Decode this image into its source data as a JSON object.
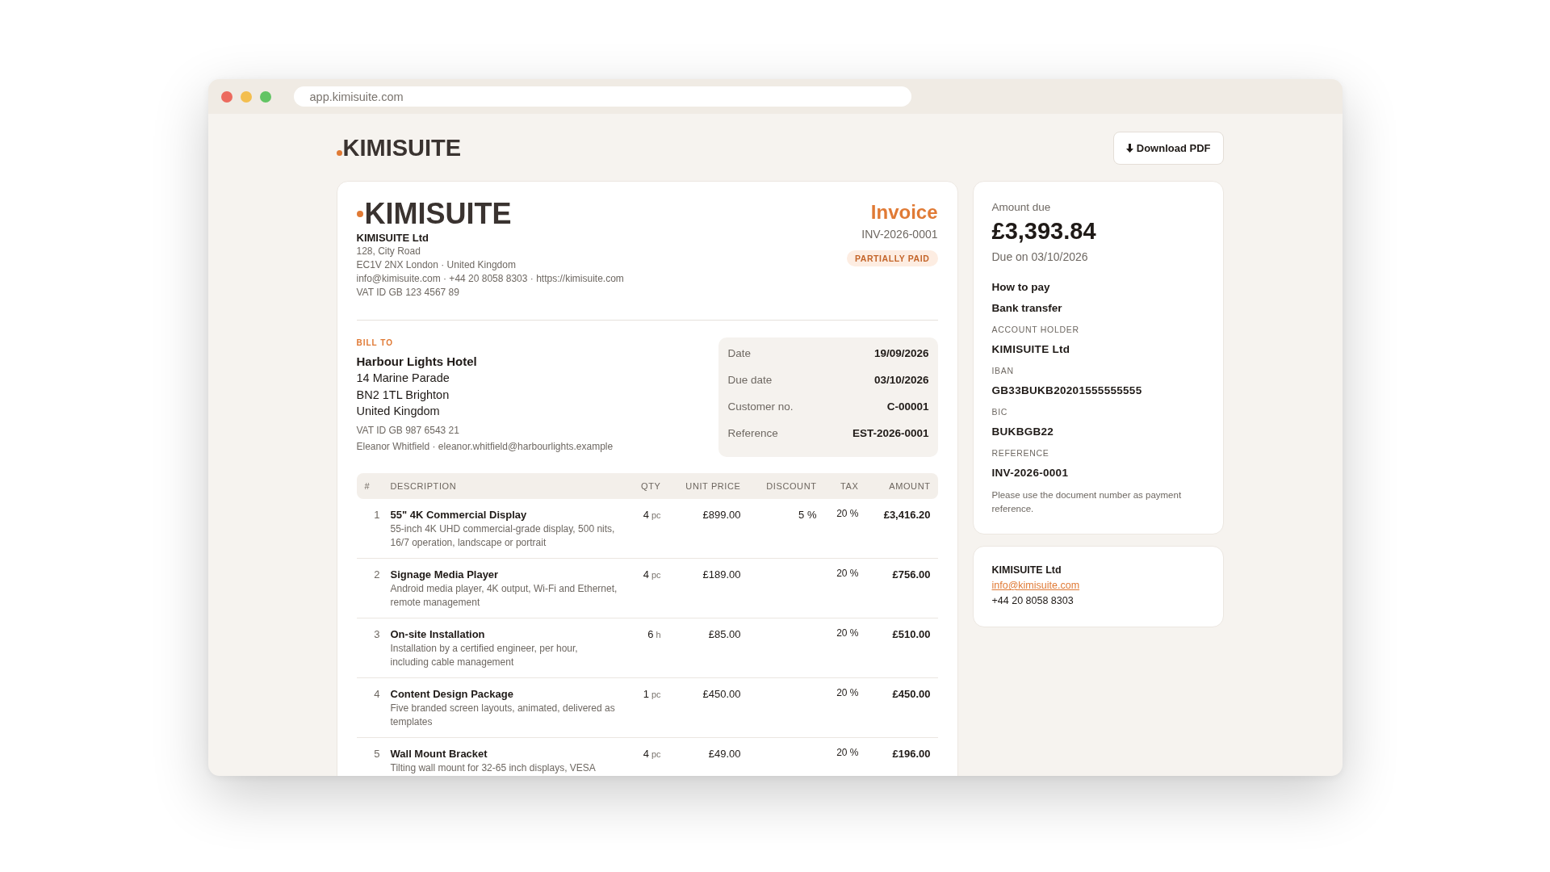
{
  "browser": {
    "url": "app.kimisuite.com"
  },
  "top_bar": {
    "logo": "KIMISUITE",
    "download_button": "Download PDF"
  },
  "invoice": {
    "logo": "KIMISUITE",
    "company": {
      "name": "KIMISUITE Ltd",
      "lines": [
        "128, City Road",
        "EC1V 2NX London · United Kingdom",
        "info@kimisuite.com · +44 20 8058 8303 · https://kimisuite.com",
        "VAT ID GB 123 4567 89"
      ]
    },
    "title": "Invoice",
    "number": "INV-2026-0001",
    "status": "PARTIALLY PAID",
    "bill_to": {
      "label": "BILL TO",
      "name": "Harbour Lights Hotel",
      "address": [
        "14 Marine Parade",
        "BN2 1TL Brighton",
        "United Kingdom"
      ],
      "vat": "VAT ID GB 987 6543 21",
      "contact": "Eleanor Whitfield · eleanor.whitfield@harbourlights.example"
    },
    "details": [
      {
        "label": "Date",
        "value": "19/09/2026"
      },
      {
        "label": "Due date",
        "value": "03/10/2026"
      },
      {
        "label": "Customer no.",
        "value": "C-00001"
      },
      {
        "label": "Reference",
        "value": "EST-2026-0001"
      }
    ],
    "table": {
      "columns": [
        "#",
        "DESCRIPTION",
        "QTY",
        "UNIT PRICE",
        "DISCOUNT",
        "TAX",
        "AMOUNT"
      ],
      "rows": [
        {
          "number": "1",
          "title": "55\" 4K Commercial Display",
          "description": "55-inch 4K UHD commercial-grade display, 500 nits, 16/7 operation, landscape or portrait",
          "qty": "4",
          "unit": "pc",
          "unit_price": "£899.00",
          "discount": "5 %",
          "tax": "20 %",
          "amount": "£3,416.20"
        },
        {
          "number": "2",
          "title": "Signage Media Player",
          "description": "Android media player, 4K output, Wi-Fi and Ethernet, remote management",
          "qty": "4",
          "unit": "pc",
          "unit_price": "£189.00",
          "tax": "20 %",
          "amount": "£756.00"
        },
        {
          "number": "3",
          "title": "On-site Installation",
          "description": "Installation by a certified engineer, per hour, including cable management",
          "qty": "6",
          "unit": "h",
          "unit_price": "£85.00",
          "tax": "20 %",
          "amount": "£510.00"
        },
        {
          "number": "4",
          "title": "Content Design Package",
          "description": "Five branded screen layouts, animated, delivered as templates",
          "qty": "1",
          "unit": "pc",
          "unit_price": "£450.00",
          "tax": "20 %",
          "amount": "£450.00"
        },
        {
          "number": "5",
          "title": "Wall Mount Bracket",
          "description": "Tilting wall mount for 32-65 inch displays, VESA",
          "qty": "4",
          "unit": "pc",
          "unit_price": "£49.00",
          "tax": "20 %",
          "amount": "£196.00"
        }
      ]
    }
  },
  "payment": {
    "amount_label": "Amount due",
    "amount": "£3,393.84",
    "due": "Due on 03/10/2026",
    "heading": "How to pay",
    "method": "Bank transfer",
    "fields": [
      {
        "label": "ACCOUNT HOLDER",
        "value": "KIMISUITE Ltd"
      },
      {
        "label": "IBAN",
        "value": "GB33BUKB20201555555555"
      },
      {
        "label": "BIC",
        "value": "BUKBGB22"
      },
      {
        "label": "REFERENCE",
        "value": "INV-2026-0001"
      }
    ],
    "note": "Please use the document number as payment reference."
  },
  "contact": {
    "name": "KIMISUITE Ltd",
    "email": "info@kimisuite.com",
    "phone": "+44 20 8058 8303"
  }
}
